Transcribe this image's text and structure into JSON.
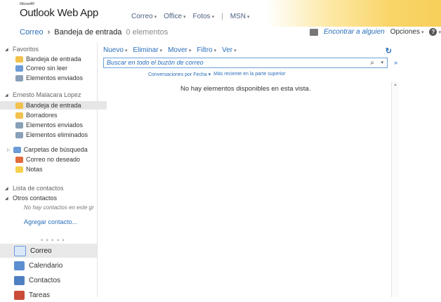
{
  "app": {
    "logo_small": "Microsoft®",
    "logo": "Outlook Web App"
  },
  "topnav": [
    {
      "label": "Correo"
    },
    {
      "label": "Office"
    },
    {
      "label": "Fotos"
    },
    {
      "label": "MSN"
    }
  ],
  "breadcrumb": {
    "root": "Correo",
    "sep": "›",
    "current": "Bandeja de entrada",
    "count": "0 elementos"
  },
  "header_right": {
    "find": "Encontrar a alguien",
    "options": "Opciones"
  },
  "sidebar": {
    "favorites_header": "Favoritos",
    "favorites": [
      "Bandeja de entrada",
      "Correo sin leer",
      "Elementos enviados"
    ],
    "account_header": "Ernesto Malacara Lopez",
    "folders": [
      "Bandeja de entrada",
      "Borradores",
      "Elementos enviados",
      "Elementos eliminados"
    ],
    "folders2": [
      "Carpetas de búsqueda",
      "Correo no deseado",
      "Notas"
    ],
    "contacts_header": "Lista de contactos",
    "other_contacts": "Otros contactos",
    "no_contacts": "No hay contactos en este gr",
    "add_contact": "Agregar contacto...",
    "dots": "• • • • •",
    "modules": [
      "Correo",
      "Calendario",
      "Contactos",
      "Tareas"
    ]
  },
  "toolbar": {
    "new": "Nuevo",
    "delete": "Eliminar",
    "move": "Mover",
    "filter": "Filtro",
    "view": "Ver"
  },
  "search": {
    "placeholder": "Buscar en todo el buzón de correo"
  },
  "sort": {
    "by": "Conversaciones por Fecha",
    "order": "Más reciente en la parte superior"
  },
  "message_list": {
    "empty": "No hay elementos disponibles en esta vista."
  },
  "colors": {
    "link": "#2a6ebb",
    "selected": "#e6e6e6",
    "accent_flare": "#f7cf5a"
  }
}
